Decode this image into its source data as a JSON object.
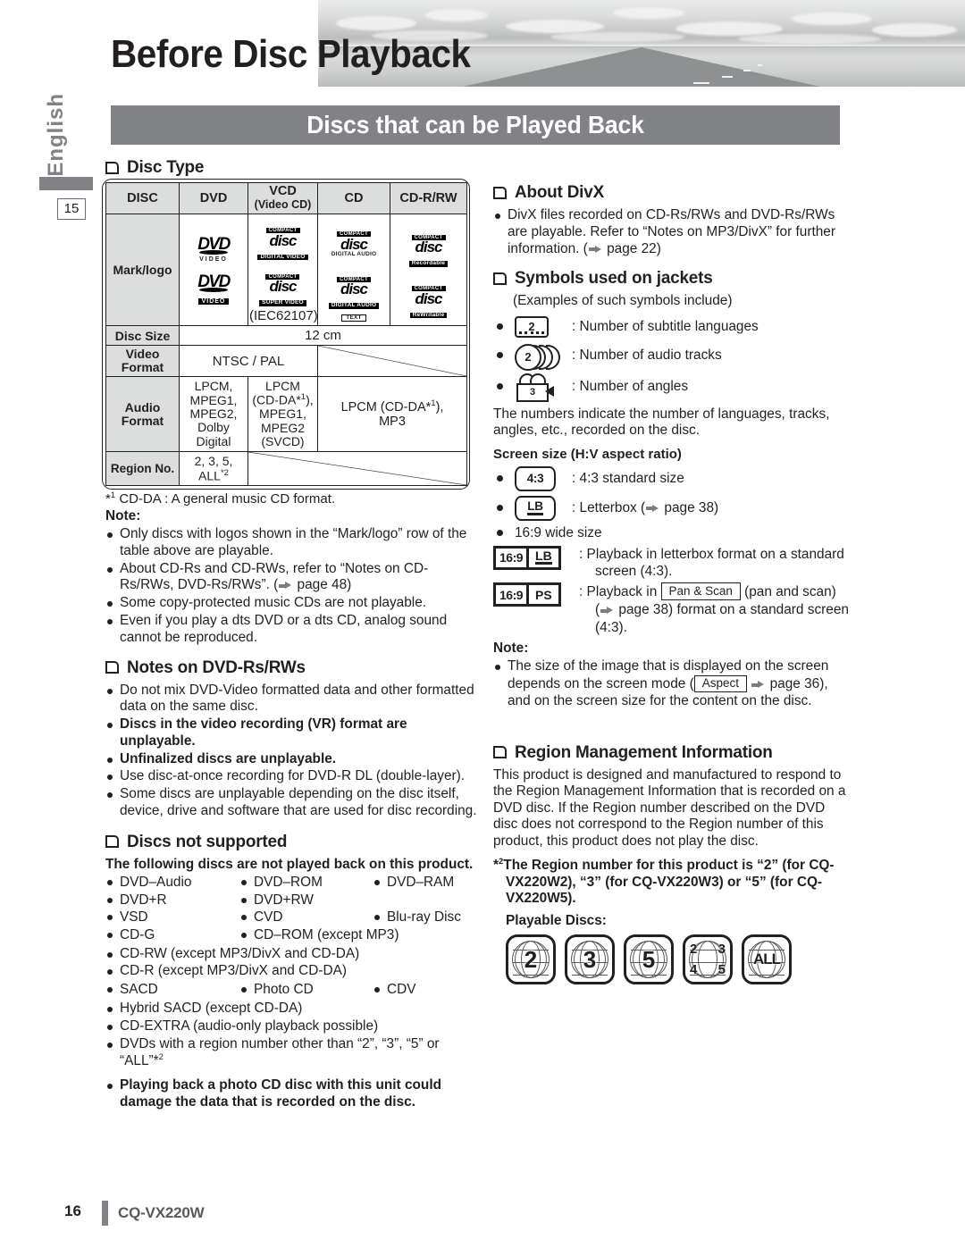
{
  "header": {
    "title": "Before Disc Playback",
    "subtitle": "Discs that can be Played Back",
    "language_tab": "English",
    "page_tab": "15"
  },
  "footer": {
    "page_number": "16",
    "model": "CQ-VX220W"
  },
  "left": {
    "disc_type_heading": "Disc Type",
    "table": {
      "columns": [
        "DISC",
        "DVD",
        "VCD",
        "CD",
        "CD-R/RW"
      ],
      "vcd_sub": "(Video CD)",
      "rows": {
        "mark_logo_label": "Mark/logo",
        "vcd_note": "(IEC62107)",
        "disc_size_label": "Disc Size",
        "disc_size_value": "12 cm",
        "video_format_label": "Video Format",
        "video_format_value": "NTSC / PAL",
        "audio_format_label": "Audio Format",
        "audio_dvd": "LPCM, MPEG1, MPEG2, Dolby Digital",
        "audio_vcd": "LPCM (CD-DA*1), MPEG1, MPEG2 (SVCD)",
        "audio_cd": "LPCM (CD-DA*1), MP3",
        "region_label": "Region No.",
        "region_value": "2, 3, 5, ALL"
      },
      "logos": {
        "dvd_1_main": "DVD",
        "dvd_1_sub": "VIDEO",
        "dvd_2_main": "DVD",
        "dvd_2_sub": "VIDEO",
        "vcd_1_top": "COMPACT",
        "vcd_1_disc": "disc",
        "vcd_1_sub": "DIGITAL VIDEO",
        "vcd_2_top": "COMPACT",
        "vcd_2_disc": "disc",
        "vcd_2_sub": "SUPER VIDEO",
        "cd_1_top": "COMPACT",
        "cd_1_disc": "disc",
        "cd_1_sub": "DIGITAL AUDIO",
        "cd_2_top": "COMPACT",
        "cd_2_disc": "disc",
        "cd_2_sub": "DIGITAL AUDIO",
        "cd_2_sub2": "TEXT",
        "cdr_1_top": "COMPACT",
        "cdr_1_disc": "disc",
        "cdr_1_sub": "Recordable",
        "cdr_2_top": "COMPACT",
        "cdr_2_disc": "disc",
        "cdr_2_sub": "ReWritable"
      }
    },
    "footnote_cdda": "CD-DA : A general music CD format.",
    "note_label": "Note:",
    "notes": [
      "Only discs with logos shown in the “Mark/logo” row of the table above are playable.",
      "About CD-Rs and CD-RWs, refer to “Notes on CD-Rs/RWs, DVD-Rs/RWs”. (→ page 48)",
      "Some copy-protected music CDs are not playable.",
      "Even if you play a dts DVD or a dts CD, analog sound cannot be reproduced."
    ],
    "dvdrw_heading": "Notes on DVD-Rs/RWs",
    "dvdrw_notes": [
      {
        "text": "Do not mix DVD-Video formatted data and other formatted data on the same disc.",
        "bold": false
      },
      {
        "text": "Discs in the video recording (VR) format are unplayable.",
        "bold": true
      },
      {
        "text": "Unfinalized discs are unplayable.",
        "bold": true
      },
      {
        "text": "Use disc-at-once recording for DVD-R DL (double-layer).",
        "bold": false
      },
      {
        "text": "Some discs are unplayable depending on the disc itself, device, drive and software that are used for disc recording.",
        "bold": false
      }
    ],
    "not_supported_heading": "Discs not supported",
    "not_supported_intro": "The following discs are not played back on this product.",
    "not_supported_grid": [
      [
        "DVD–Audio",
        "DVD–ROM",
        "DVD–RAM"
      ],
      [
        "DVD+R",
        "DVD+RW",
        ""
      ],
      [
        "VSD",
        "CVD",
        "Blu-ray Disc"
      ],
      [
        "CD-G",
        "CD–ROM (except MP3)",
        ""
      ]
    ],
    "not_supported_list": [
      "CD-RW (except MP3/DivX and CD-DA)",
      "CD-R (except MP3/DivX and CD-DA)"
    ],
    "not_supported_grid2": [
      [
        "SACD",
        "Photo CD",
        "CDV"
      ]
    ],
    "not_supported_list2": [
      "Hybrid SACD (except CD-DA)",
      "CD-EXTRA (audio-only playback possible)",
      "DVDs with a region number other than “2”, “3”, “5” or “ALL”*2"
    ],
    "warning_bold": "Playing back a photo CD disc with this unit could damage the data that is recorded on the disc."
  },
  "right": {
    "divx_heading": "About DivX",
    "divx_note": "DivX files recorded on CD-Rs/RWs and DVD-Rs/RWs are playable. Refer to “Notes on MP3/DivX” for further information. (→ page 22)",
    "symbols_heading": "Symbols used on jackets",
    "symbols_intro": "(Examples of such symbols include)",
    "symbol_rows": [
      {
        "icon": "subtitle-icon",
        "value": "2",
        "label": ": Number of subtitle languages"
      },
      {
        "icon": "audio-track-icon",
        "value": "2",
        "label": ": Number of audio tracks"
      },
      {
        "icon": "angle-icon",
        "value": "3",
        "label": ": Number of angles"
      }
    ],
    "symbols_explain": "The numbers indicate the number of languages, tracks, angles, etc., recorded on the disc.",
    "screen_size_heading": "Screen size (H:V aspect ratio)",
    "aspect_rows": [
      {
        "icon": "4:3",
        "label": ": 4:3 standard size"
      },
      {
        "icon": "LB",
        "label": ": Letterbox (→ page 38)"
      }
    ],
    "wide_label": "16:9 wide size",
    "wide_rows": [
      {
        "left": "16:9",
        "right": "LB",
        "label": ": Playback in letterbox format on a standard screen (4:3)."
      },
      {
        "left": "16:9",
        "right": "PS",
        "label_pre": ": Playback in ",
        "box": "Pan & Scan",
        "label_post": " (pan and scan) (→ page 38) format on a standard screen (4:3)."
      }
    ],
    "note_label": "Note:",
    "note_pre": "The size of the image that is displayed on the screen depends on the screen mode (",
    "note_box": "Aspect",
    "note_post": " → page 36), and on the screen size for the content on the disc.",
    "region_heading": "Region Management Information",
    "region_body": "This product is designed and manufactured to respond to the Region Management Information that is recorded on a DVD disc. If the Region number described on the DVD disc does not correspond to the Region number of this product, this product does not play the disc.",
    "region_footnote": "The Region number for this product is “2” (for CQ-VX220W2), “3” (for CQ-VX220W3) or “5” (for CQ-VX220W5).",
    "playable_label": "Playable Discs:",
    "playable_discs": [
      "2",
      "3",
      "5",
      "2 3 4 5",
      "ALL"
    ]
  }
}
